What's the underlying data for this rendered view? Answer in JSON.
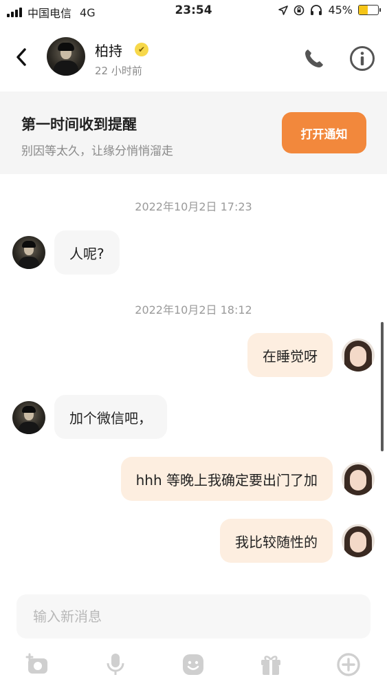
{
  "status_bar": {
    "carrier": "中国电信",
    "network": "4G",
    "time": "23:54",
    "battery_percent": "45%",
    "battery_level": 0.45
  },
  "header": {
    "contact_name": "柏持",
    "last_seen": "22 小时前",
    "icons": [
      "back-icon",
      "phone-icon",
      "info-icon"
    ]
  },
  "notice": {
    "title": "第一时间收到提醒",
    "subtitle": "别因等太久，让缘分悄悄溜走",
    "button_label": "打开通知",
    "button_color": "#f2883c"
  },
  "messages": {
    "time_1": "2022年10月2日 17:23",
    "time_2": "2022年10月2日 18:12",
    "items": [
      {
        "from": "other",
        "text": "人呢?"
      },
      {
        "from": "self",
        "text": "在睡觉呀"
      },
      {
        "from": "other",
        "text": "加个微信吧，"
      },
      {
        "from": "self",
        "text": "hhh 等晚上我确定要出门了加"
      },
      {
        "from": "self",
        "text": "我比较随性的"
      }
    ]
  },
  "composer": {
    "placeholder": "输入新消息",
    "tools": [
      "image-icon",
      "microphone-icon",
      "emoji-icon",
      "gift-icon",
      "plus-icon"
    ]
  },
  "colors": {
    "accent": "#f2883c",
    "bubble_self": "#fdeee0",
    "bubble_other": "#f6f6f6",
    "banner_bg": "#f5f5f5"
  }
}
